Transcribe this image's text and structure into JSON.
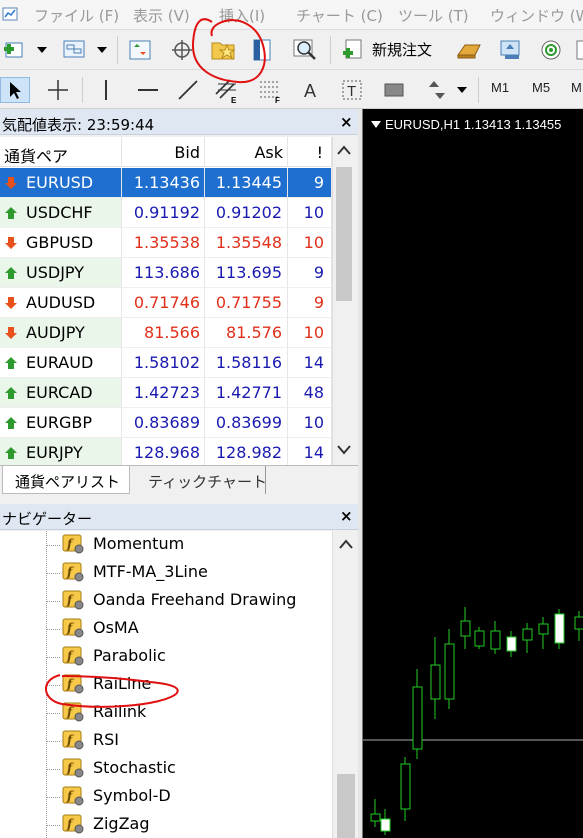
{
  "menu": [
    "ファイル (F)",
    "表示 (V)",
    "挿入(I)",
    "チャート (C)",
    "ツール (T)",
    "ウィンドウ (W)"
  ],
  "toolbar": {
    "new_order_label": "新規注文",
    "timeframes": [
      "M1",
      "M5",
      "M"
    ]
  },
  "market_watch": {
    "title": "気配値表示: 23:59:44",
    "columns": [
      "通貨ペア",
      "Bid",
      "Ask",
      "!"
    ],
    "rows": [
      {
        "symbol": "EURUSD",
        "bid": "1.13436",
        "ask": "1.13445",
        "spread": "9",
        "direction": "down",
        "color": "#1a1ab0"
      },
      {
        "symbol": "USDCHF",
        "bid": "0.91192",
        "ask": "0.91202",
        "spread": "10",
        "direction": "up",
        "color": "#1a1ab0"
      },
      {
        "symbol": "GBPUSD",
        "bid": "1.35538",
        "ask": "1.35548",
        "spread": "10",
        "direction": "down",
        "color": "#e0301a"
      },
      {
        "symbol": "USDJPY",
        "bid": "113.686",
        "ask": "113.695",
        "spread": "9",
        "direction": "up",
        "color": "#1a1ab0"
      },
      {
        "symbol": "AUDUSD",
        "bid": "0.71746",
        "ask": "0.71755",
        "spread": "9",
        "direction": "down",
        "color": "#e0301a"
      },
      {
        "symbol": "AUDJPY",
        "bid": "81.566",
        "ask": "81.576",
        "spread": "10",
        "direction": "down",
        "color": "#e0301a"
      },
      {
        "symbol": "EURAUD",
        "bid": "1.58102",
        "ask": "1.58116",
        "spread": "14",
        "direction": "up",
        "color": "#1a1ab0"
      },
      {
        "symbol": "EURCAD",
        "bid": "1.42723",
        "ask": "1.42771",
        "spread": "48",
        "direction": "up",
        "color": "#1a1ab0"
      },
      {
        "symbol": "EURGBP",
        "bid": "0.83689",
        "ask": "0.83699",
        "spread": "10",
        "direction": "up",
        "color": "#1a1ab0"
      },
      {
        "symbol": "EURJPY",
        "bid": "128.968",
        "ask": "128.982",
        "spread": "14",
        "direction": "up",
        "color": "#1a1ab0"
      }
    ],
    "tabs": [
      "通貨ペアリスト",
      "ティックチャート"
    ]
  },
  "navigator": {
    "title": "ナビゲーター",
    "items": [
      "Momentum",
      "MTF-MA_3Line",
      "Oanda Freehand Drawing",
      "OsMA",
      "Parabolic",
      "RaiLine",
      "Railink",
      "RSI",
      "Stochastic",
      "Symbol-D",
      "ZigZag"
    ]
  },
  "chart": {
    "title": "EURUSD,H1  1.13413 1.13455"
  },
  "colors": {
    "selected_row": "#1e6fd0",
    "title_bar": "#dfe7f2",
    "down_arrow": "#e8501c",
    "up_arrow": "#2e9a2e",
    "chart_bg": "#000000",
    "candle_green": "#22cc22",
    "annotation": "#e01010"
  }
}
